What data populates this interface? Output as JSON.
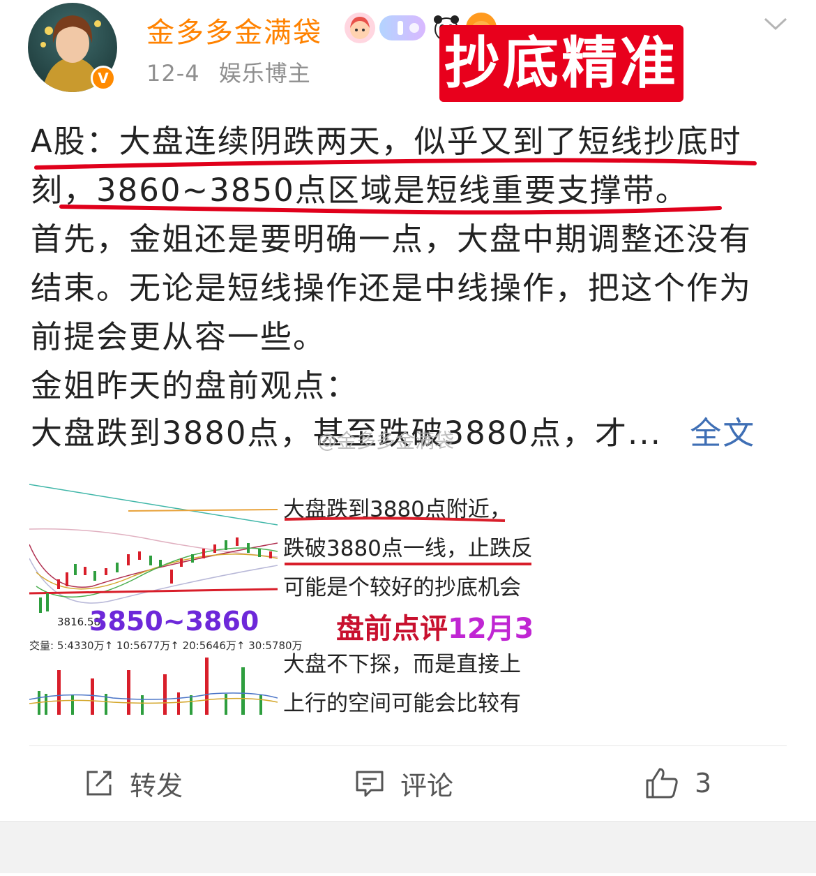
{
  "post": {
    "username": "金多多金满袋",
    "date": "12-4",
    "category": "娱乐博主",
    "verified_badge": "V",
    "stamp_text": "抄底精准"
  },
  "content": {
    "lines": [
      "A股：大盘连续阴跌两天，似乎又到了短线抄底时",
      "刻，3860~3850点区域是短线重要支撑带。",
      "首先，金姐还是要明确一点，大盘中期调整还没有",
      "结束。无论是短线操作还是中线操作，把这个作为",
      "前提会更从容一些。",
      "金姐昨天的盘前观点：",
      "大盘跌到3880点，甚至跌破3880点，才..."
    ],
    "more_label": "全文",
    "watermark": "@金多多金满袋"
  },
  "image": {
    "price_range": "3850~3860",
    "low_price": "3816.58",
    "volume_label": "交量: 5:4330万↑ 10:5677万↑ 20:5646万↑ 30:5780万",
    "notes": [
      "大盘跌到3880点附近，",
      "跌破3880点一线，止跌反",
      "可能是个较好的抄底机会",
      "大盘不下探，而是直接上",
      "上行的空间可能会比较有"
    ],
    "note_title": "盘前点评",
    "note_date": "12月3"
  },
  "actions": {
    "repost_label": "转发",
    "comment_label": "评论",
    "like_count": "3"
  },
  "colors": {
    "username": "#ff8200",
    "stamp": "#e8001c",
    "underline": "#e0001b",
    "link": "#3f6fb5"
  }
}
